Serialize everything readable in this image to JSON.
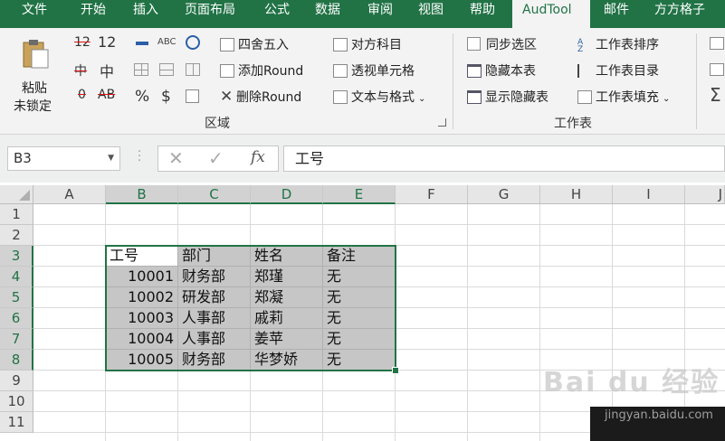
{
  "tabs": [
    "文件",
    "开始",
    "插入",
    "页面布局",
    "公式",
    "数据",
    "审阅",
    "视图",
    "帮助",
    "AudTool",
    "邮件",
    "方方格子"
  ],
  "active_tab": "AudTool",
  "ribbon": {
    "paste_label_1": "粘贴",
    "paste_label_2": "未锁定",
    "num_icons_row1": [
      "12",
      "12"
    ],
    "num_icons_row2": [
      "中",
      "中"
    ],
    "num_icons_row3": [
      "0",
      "AB"
    ],
    "symbols_row3": [
      "%",
      "$"
    ],
    "round_buttons": [
      "四舍五入",
      "添加Round",
      "删除Round"
    ],
    "align_buttons": [
      "对方科目",
      "透视单元格",
      "文本与格式"
    ],
    "group_region": "区域",
    "sheet_checks": [
      "同步选区",
      "隐藏本表",
      "显示隐藏表"
    ],
    "sheet_buttons": [
      "工作表排序",
      "工作表目录",
      "工作表填充"
    ],
    "group_sheet": "工作表"
  },
  "formula_bar": {
    "name_box": "B3",
    "fx": "fx",
    "content": "工号"
  },
  "columns": [
    "A",
    "B",
    "C",
    "D",
    "E",
    "F",
    "G",
    "H",
    "I",
    "J"
  ],
  "rows": [
    "1",
    "2",
    "3",
    "4",
    "5",
    "6",
    "7",
    "8",
    "9",
    "10",
    "11"
  ],
  "table": {
    "header": [
      "工号",
      "部门",
      "姓名",
      "备注"
    ],
    "data": [
      [
        "10001",
        "财务部",
        "郑瑾",
        "无"
      ],
      [
        "10002",
        "研发部",
        "郑凝",
        "无"
      ],
      [
        "10003",
        "人事部",
        "戚莉",
        "无"
      ],
      [
        "10004",
        "人事部",
        "姜苹",
        "无"
      ],
      [
        "10005",
        "财务部",
        "华梦娇",
        "无"
      ]
    ]
  },
  "watermark": {
    "brand": "Bai du 经验",
    "url": "jingyan.baidu.com"
  },
  "colors": {
    "excel_green": "#217346",
    "selection_gray": "#c6c6c6"
  }
}
